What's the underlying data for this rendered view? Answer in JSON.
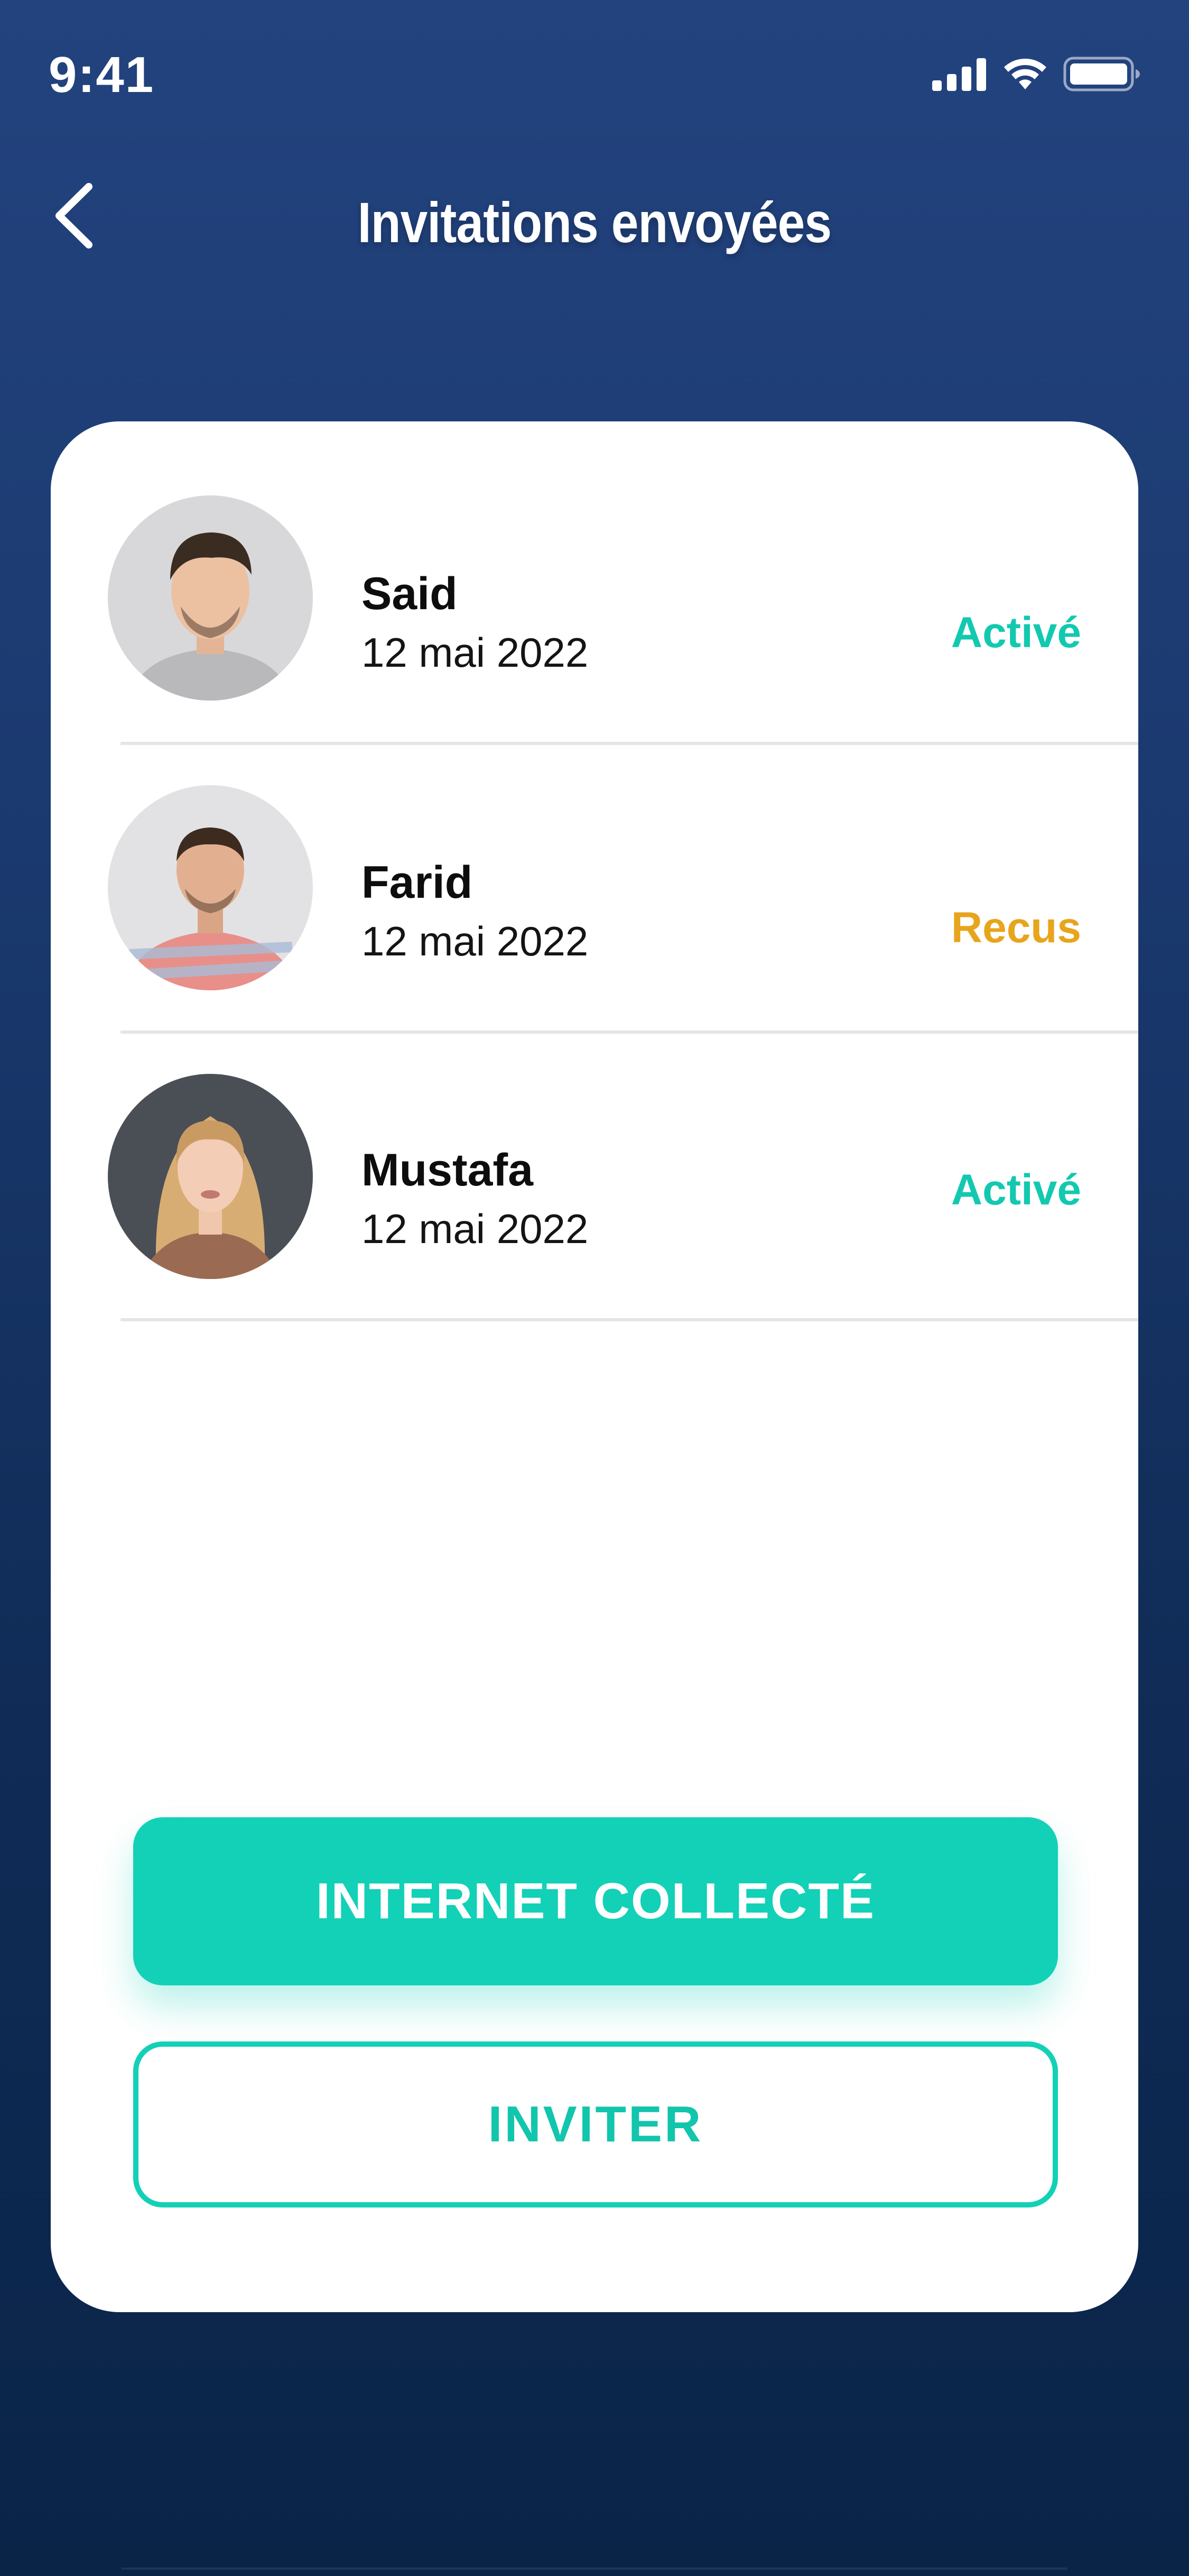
{
  "status_bar": {
    "time": "9:41",
    "icons": [
      "cellular-signal-icon",
      "wifi-icon",
      "battery-icon"
    ]
  },
  "header": {
    "title": "Invitations envoyées",
    "back_icon": "chevron-left-icon"
  },
  "invitations": [
    {
      "name": "Said",
      "date": "12 mai 2022",
      "status": "Activé",
      "status_color": "#12c9b0"
    },
    {
      "name": "Farid",
      "date": "12 mai 2022",
      "status": "Recus",
      "status_color": "#e7a51c"
    },
    {
      "name": "Mustafa",
      "date": "12 mai 2022",
      "status": "Activé",
      "status_color": "#12c9b0"
    }
  ],
  "actions": {
    "primary_label": "INTERNET COLLECTÉ",
    "secondary_label": "INVITER"
  },
  "colors": {
    "accent": "#12d1b7",
    "background_top": "#23437f",
    "background_bottom": "#0a2448",
    "pending": "#e7a51c"
  }
}
